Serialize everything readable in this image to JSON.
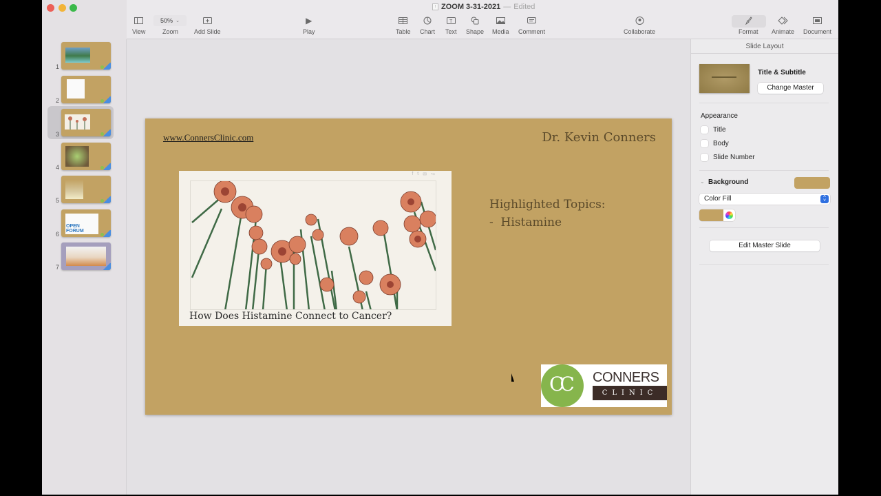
{
  "window": {
    "title": "ZOOM 3-31-2021",
    "separator": "—",
    "status": "Edited"
  },
  "toolbar": {
    "view": "View",
    "zoom_value": "50%",
    "zoom": "Zoom",
    "add_slide": "Add Slide",
    "play": "Play",
    "table": "Table",
    "chart": "Chart",
    "text": "Text",
    "shape": "Shape",
    "media": "Media",
    "comment": "Comment",
    "collaborate": "Collaborate",
    "format": "Format",
    "animate": "Animate",
    "document": "Document"
  },
  "navigator": {
    "selected": 3,
    "slides": [
      {
        "number": "1",
        "content": "beach photo"
      },
      {
        "number": "2",
        "content": "device photo"
      },
      {
        "number": "3",
        "content": "flowers illustration"
      },
      {
        "number": "4",
        "content": "sprouts photo"
      },
      {
        "number": "5",
        "content": "lamp photo"
      },
      {
        "number": "6",
        "content": "OPEN FORUM"
      },
      {
        "number": "7",
        "content": "sunset text slide"
      }
    ]
  },
  "slide": {
    "url": "www.ConnersClinic.com",
    "author": "Dr. Kevin Conners",
    "topics_heading": "Highlighted Topics:",
    "topics_item": "-  Histamine",
    "article_caption": "How Does Histamine Connect to Cancer?",
    "share_icons": [
      "f",
      "t",
      "✉",
      "↪"
    ],
    "logo_initials": "CC",
    "logo_name": "CONNERS",
    "logo_sub": "CLINIC",
    "background_color": "#c2a263"
  },
  "inspector": {
    "header": "Slide Layout",
    "master_name": "Title & Subtitle",
    "change_master": "Change Master",
    "appearance_label": "Appearance",
    "appearance": [
      {
        "label": "Title",
        "checked": false
      },
      {
        "label": "Body",
        "checked": false
      },
      {
        "label": "Slide Number",
        "checked": false
      }
    ],
    "background_label": "Background",
    "fill_type": "Color Fill",
    "fill_color": "#c2a263",
    "edit_master": "Edit Master Slide"
  }
}
